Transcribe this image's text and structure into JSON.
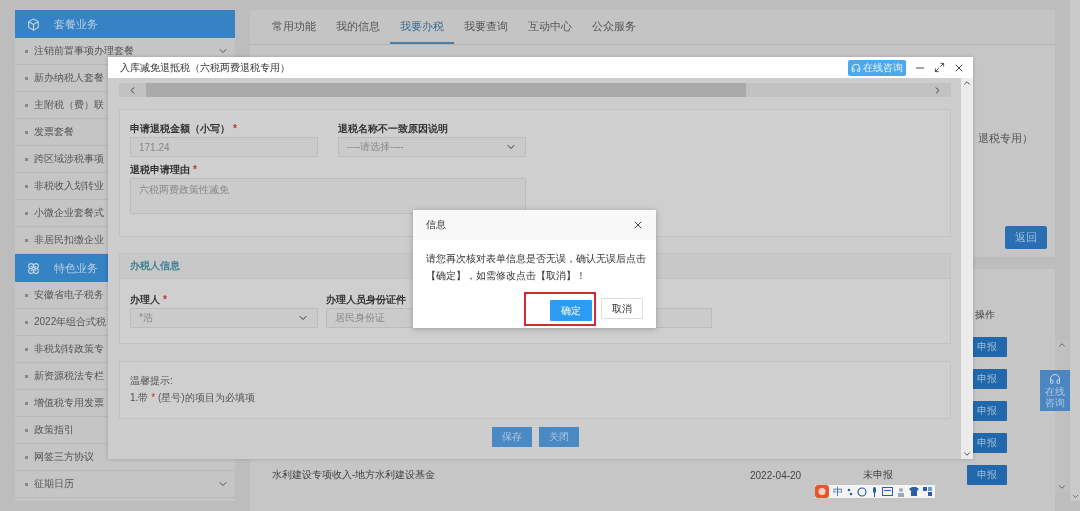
{
  "sidebar": {
    "sections": [
      {
        "title": "套餐业务",
        "items": [
          {
            "label": "注销前置事项办理套餐"
          },
          {
            "label": "新办纳税人套餐"
          },
          {
            "label": "主附税（费）联"
          },
          {
            "label": "发票套餐"
          },
          {
            "label": "跨区域涉税事项"
          },
          {
            "label": "非税收入划转业"
          },
          {
            "label": "小微企业套餐式"
          },
          {
            "label": "非居民扣缴企业"
          }
        ]
      },
      {
        "title": "特色业务",
        "items": [
          {
            "label": "安徽省电子税务"
          },
          {
            "label": "2022年组合式税"
          },
          {
            "label": "非税划转政策专"
          },
          {
            "label": "新资源税法专栏"
          },
          {
            "label": "增值税专用发票"
          },
          {
            "label": "政策指引"
          },
          {
            "label": "网签三方协议"
          },
          {
            "label": "征期日历"
          }
        ]
      }
    ]
  },
  "tabs": [
    {
      "label": "常用功能",
      "selected": false
    },
    {
      "label": "我的信息",
      "selected": false
    },
    {
      "label": "我要办税",
      "selected": true
    },
    {
      "label": "我要查询",
      "selected": false
    },
    {
      "label": "互动中心",
      "selected": false
    },
    {
      "label": "公众服务",
      "selected": false
    }
  ],
  "upper_panel": {
    "lines": [
      "退税专用）"
    ],
    "back_button": "返回"
  },
  "table": {
    "header": "操作",
    "rows": [
      {
        "action": "申报"
      },
      {
        "action": "申报"
      },
      {
        "action": "申报"
      },
      {
        "action": "申报"
      },
      {
        "name": "水利建设专项收入-地方水利建设基金",
        "date": "2022-04-20",
        "status": "未申报",
        "action": "申报"
      }
    ]
  },
  "support_widget": {
    "label": "在线咨询"
  },
  "ime_toolbar": {
    "mode": "中"
  },
  "modal": {
    "title": "入库减免退抵税（六税两费退税专用）",
    "support_button": "在线咨询",
    "refund_fields": [
      {
        "kind": "input",
        "label": "申请退税金额（小写）",
        "mark": "*",
        "value": "171.24"
      },
      {
        "kind": "select",
        "label": "退税名称不一致原因说明",
        "value": "----请选择----"
      },
      {
        "kind": "textarea",
        "label": "退税申请理由",
        "mark": "*",
        "value": "六税两费政策性减免"
      }
    ],
    "handler_section": {
      "title": "办税人信息",
      "fields": [
        {
          "kind": "select",
          "label": "办理人",
          "mark": "*",
          "value": "*浩"
        },
        {
          "kind": "input",
          "label": "办理人员身份证件",
          "value": "居民身份证"
        },
        {
          "kind": "input"
        }
      ]
    },
    "tips": {
      "title": "温馨提示:",
      "prefix": "1.带",
      "mark": "*",
      "suffix": "(星号)的项目为必填项"
    },
    "buttons": [
      "保存",
      "关闭"
    ]
  },
  "dialog": {
    "title": "信息",
    "message": "请您再次核对表单信息是否无误，确认无误后点击【确定】，如需修改点击【取消】！",
    "buttons": [
      {
        "label": "确定",
        "kind": "primary",
        "highlighted": true
      },
      {
        "label": "取消",
        "kind": "default",
        "highlighted": false
      }
    ]
  }
}
